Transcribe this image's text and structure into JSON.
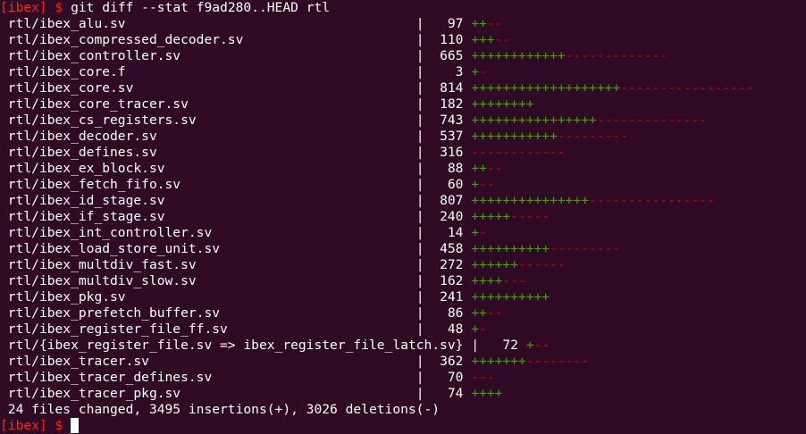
{
  "prompt": {
    "host": "[ibex]",
    "symbol": "$"
  },
  "command": "git diff --stat f9ad280..HEAD rtl",
  "files": [
    {
      "path": "rtl/ibex_alu.sv",
      "sep": "|",
      "count": "97",
      "plus": "++",
      "minus": "--"
    },
    {
      "path": "rtl/ibex_compressed_decoder.sv",
      "sep": "|",
      "count": "110",
      "plus": "+++",
      "minus": "--"
    },
    {
      "path": "rtl/ibex_controller.sv",
      "sep": "|",
      "count": "665",
      "plus": "++++++++++++",
      "minus": "-------------"
    },
    {
      "path": "rtl/ibex_core.f",
      "sep": "|",
      "count": "3",
      "plus": "+",
      "minus": "-"
    },
    {
      "path": "rtl/ibex_core.sv",
      "sep": "|",
      "count": "814",
      "plus": "+++++++++++++++++++",
      "minus": "-----------------"
    },
    {
      "path": "rtl/ibex_core_tracer.sv",
      "sep": "|",
      "count": "182",
      "plus": "++++++++",
      "minus": ""
    },
    {
      "path": "rtl/ibex_cs_registers.sv",
      "sep": "|",
      "count": "743",
      "plus": "++++++++++++++++",
      "minus": "--------------"
    },
    {
      "path": "rtl/ibex_decoder.sv",
      "sep": "|",
      "count": "537",
      "plus": "+++++++++++",
      "minus": "---------"
    },
    {
      "path": "rtl/ibex_defines.sv",
      "sep": "|",
      "count": "316",
      "plus": "",
      "minus": "------------"
    },
    {
      "path": "rtl/ibex_ex_block.sv",
      "sep": "|",
      "count": "88",
      "plus": "++",
      "minus": "--"
    },
    {
      "path": "rtl/ibex_fetch_fifo.sv",
      "sep": "|",
      "count": "60",
      "plus": "+",
      "minus": "--"
    },
    {
      "path": "rtl/ibex_id_stage.sv",
      "sep": "|",
      "count": "807",
      "plus": "+++++++++++++++",
      "minus": "----------------"
    },
    {
      "path": "rtl/ibex_if_stage.sv",
      "sep": "|",
      "count": "240",
      "plus": "+++++",
      "minus": "-----"
    },
    {
      "path": "rtl/ibex_int_controller.sv",
      "sep": "|",
      "count": "14",
      "plus": "+",
      "minus": "-"
    },
    {
      "path": "rtl/ibex_load_store_unit.sv",
      "sep": "|",
      "count": "458",
      "plus": "++++++++++",
      "minus": "---------"
    },
    {
      "path": "rtl/ibex_multdiv_fast.sv",
      "sep": "|",
      "count": "272",
      "plus": "++++++",
      "minus": "------"
    },
    {
      "path": "rtl/ibex_multdiv_slow.sv",
      "sep": "|",
      "count": "162",
      "plus": "++++",
      "minus": "---"
    },
    {
      "path": "rtl/ibex_pkg.sv",
      "sep": "|",
      "count": "241",
      "plus": "++++++++++",
      "minus": ""
    },
    {
      "path": "rtl/ibex_prefetch_buffer.sv",
      "sep": "|",
      "count": "86",
      "plus": "++",
      "minus": "--"
    },
    {
      "path": "rtl/ibex_register_file_ff.sv",
      "sep": "|",
      "count": "48",
      "plus": "+",
      "minus": "-"
    },
    {
      "path": "rtl/{ibex_register_file.sv => ibex_register_file_latch.sv}",
      "sep": "|",
      "count": "72",
      "plus": "+",
      "minus": "--"
    },
    {
      "path": "rtl/ibex_tracer.sv",
      "sep": "|",
      "count": "362",
      "plus": "+++++++",
      "minus": "--------"
    },
    {
      "path": "rtl/ibex_tracer_defines.sv",
      "sep": "|",
      "count": "70",
      "plus": "",
      "minus": "---"
    },
    {
      "path": "rtl/ibex_tracer_pkg.sv",
      "sep": "|",
      "count": "74",
      "plus": "++++",
      "minus": ""
    }
  ],
  "summary": "24 files changed, 3495 insertions(+), 3026 deletions(-)",
  "colors": {
    "background": "#300a24",
    "text": "#ffffff",
    "prompt": "#ef2929",
    "insertion": "#4e9a06",
    "deletion": "#cc0000"
  }
}
